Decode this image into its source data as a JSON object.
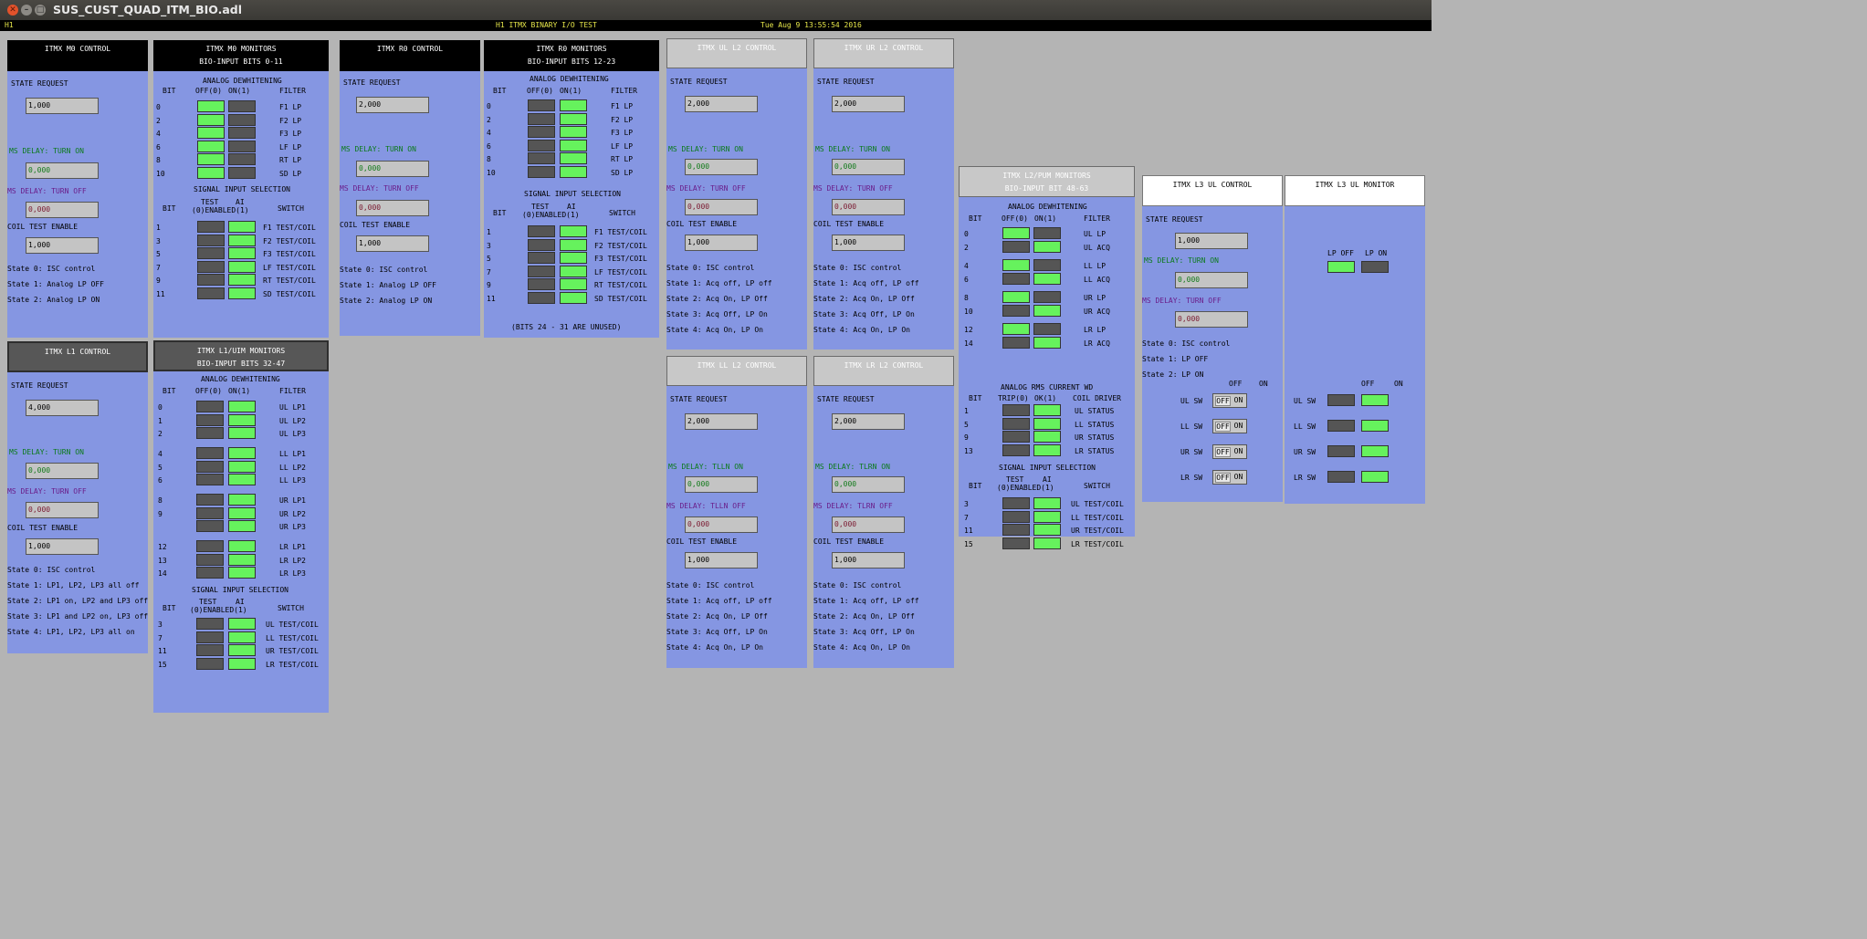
{
  "window": {
    "title": "SUS_CUST_QUAD_ITM_BIO.adl"
  },
  "status": {
    "site": "H1",
    "screen": "H1 ITMX BINARY I/O TEST",
    "datetime": "Tue Aug  9 13:55:54 2016"
  },
  "colors": {
    "panel": "#8596e2",
    "led_on": "#66f25d",
    "led_off": "#555555",
    "background": "#b4b4b4"
  },
  "m0_ctrl": {
    "title": "ITMX M0 CONTROL",
    "state_request_label": "STATE REQUEST",
    "state_request": "1,000",
    "delay_on_label": "MS DELAY: TURN ON",
    "delay_on": "0,000",
    "delay_off_label": "MS DELAY: TURN OFF",
    "delay_off": "0,000",
    "coil_label": "COIL TEST ENABLE",
    "coil": "1,000",
    "states": [
      "State 0: ISC control",
      "State 1: Analog LP OFF",
      "State 2: Analog LP ON"
    ]
  },
  "r0_ctrl": {
    "title": "ITMX R0 CONTROL",
    "state_request_label": "STATE REQUEST",
    "state_request": "2,000",
    "delay_on_label": "MS DELAY: TURN ON",
    "delay_on": "0,000",
    "delay_off_label": "MS DELAY: TURN OFF",
    "delay_off": "0,000",
    "coil_label": "COIL TEST ENABLE",
    "coil": "1,000",
    "states": [
      "State 0: ISC control",
      "State 1: Analog LP OFF",
      "State 2: Analog LP ON"
    ]
  },
  "l1_ctrl": {
    "title": "ITMX L1 CONTROL",
    "state_request_label": "STATE REQUEST",
    "state_request": "4,000",
    "delay_on_label": "MS DELAY: TURN ON",
    "delay_on": "0,000",
    "delay_off_label": "MS DELAY: TURN OFF",
    "delay_off": "0,000",
    "coil_label": "COIL TEST ENABLE",
    "coil": "1,000",
    "states": [
      "State 0: ISC control",
      "State 1: LP1, LP2, LP3 all off",
      "State 2: LP1 on, LP2 and LP3 off",
      "State 3: LP1 and LP2 on, LP3 off",
      "State 4: LP1, LP2, LP3 all on"
    ]
  },
  "ul_l2_ctrl": {
    "title": "ITMX UL L2 CONTROL",
    "state_request_label": "STATE REQUEST",
    "state_request": "2,000",
    "delay_on_label": "MS DELAY: TURN ON",
    "delay_on": "0,000",
    "delay_off_label": "MS DELAY: TURN OFF",
    "delay_off": "0,000",
    "coil_label": "COIL TEST ENABLE",
    "coil": "1,000",
    "states": [
      "State 0: ISC control",
      "State 1: Acq off, LP off",
      "State 2: Acq On, LP Off",
      "State 3: Acq Off, LP On",
      "State 4: Acq On, LP On"
    ]
  },
  "ur_l2_ctrl": {
    "title": "ITMX UR L2 CONTROL",
    "state_request_label": "STATE REQUEST",
    "state_request": "2,000",
    "delay_on_label": "MS DELAY: TURN ON",
    "delay_on": "0,000",
    "delay_off_label": "MS DELAY: TURN OFF",
    "delay_off": "0,000",
    "coil_label": "COIL TEST ENABLE",
    "coil": "1,000",
    "states": [
      "State 0: ISC control",
      "State 1: Acq off, LP off",
      "State 2: Acq On, LP Off",
      "State 3: Acq Off, LP On",
      "State 4: Acq On, LP On"
    ]
  },
  "ll_l2_ctrl": {
    "title": "ITMX LL L2 CONTROL",
    "state_request_label": "STATE REQUEST",
    "state_request": "2,000",
    "delay_on_label": "MS DELAY: TLLN ON",
    "delay_on": "0,000",
    "delay_off_label": "MS DELAY: TLLN OFF",
    "delay_off": "0,000",
    "coil_label": "COIL TEST ENABLE",
    "coil": "1,000",
    "states": [
      "State 0: ISC control",
      "State 1: Acq off, LP off",
      "State 2: Acq On, LP Off",
      "State 3: Acq Off, LP On",
      "State 4: Acq On, LP On"
    ]
  },
  "lr_l2_ctrl": {
    "title": "ITMX LR L2 CONTROL",
    "state_request_label": "STATE REQUEST",
    "state_request": "2,000",
    "delay_on_label": "MS DELAY: TLRN ON",
    "delay_on": "0,000",
    "delay_off_label": "MS DELAY: TLRN OFF",
    "delay_off": "0,000",
    "coil_label": "COIL TEST ENABLE",
    "coil": "1,000",
    "states": [
      "State 0: ISC control",
      "State 1: Acq off, LP off",
      "State 2: Acq On, LP Off",
      "State 3: Acq Off, LP On",
      "State 4: Acq On, LP On"
    ]
  },
  "l3_ctrl": {
    "title": "ITMX L3 UL CONTROL",
    "state_request_label": "STATE REQUEST",
    "state_request": "1,000",
    "delay_on_label": "MS DELAY: TURN ON",
    "delay_on": "0,000",
    "delay_off_label": "MS DELAY: TURN OFF",
    "delay_off": "0,000",
    "states": [
      "State 0: ISC control",
      "State 1: LP OFF",
      "State 2: LP ON"
    ],
    "off_label": "OFF",
    "on_label": "ON",
    "switch_labels": [
      "UL SW",
      "LL SW",
      "UR SW",
      "LR SW"
    ],
    "toggle_off": "OFF",
    "toggle_on": "ON",
    "sw_states": [
      false,
      false,
      false,
      false,
      true,
      true,
      true,
      true
    ]
  },
  "l3_mon": {
    "title": "ITMX L3 UL MONITOR",
    "lp_off_label": "LP OFF",
    "lp_on_label": "LP ON",
    "lp_states": [
      true,
      false
    ]
  },
  "m0_mon": {
    "title1": "ITMX M0 MONITORS",
    "title2": "BIO-INPUT BITS 0-11",
    "dw_title": "ANALOG DEWHITENING",
    "col_bit": "BIT",
    "col_off": "OFF(0)",
    "col_on": "ON(1)",
    "col_filter": "FILTER",
    "dw_bits": [
      "0",
      "2",
      "4",
      "6",
      "8",
      "10"
    ],
    "dw_filters": [
      "F1 LP",
      "F2 LP",
      "F3 LP",
      "LF LP",
      "RT LP",
      "SD LP"
    ],
    "dw_states": [
      true,
      false,
      true,
      false,
      true,
      false,
      true,
      false,
      true,
      false,
      true,
      false
    ],
    "sig_title": "SIGNAL INPUT SELECTION",
    "col_test": "TEST",
    "col_ai": "AI",
    "col_enabled": "(0)ENABLED(1)",
    "col_switch": "SWITCH",
    "sig_bits": [
      "1",
      "3",
      "5",
      "7",
      "9",
      "11"
    ],
    "sig_switches": [
      "F1 TEST/COIL",
      "F2 TEST/COIL",
      "F3 TEST/COIL",
      "LF TEST/COIL",
      "RT TEST/COIL",
      "SD TEST/COIL"
    ],
    "sig_states": [
      false,
      true,
      false,
      true,
      false,
      true,
      false,
      true,
      false,
      true,
      false,
      true
    ]
  },
  "r0_mon": {
    "title1": "ITMX R0 MONITORS",
    "title2": "BIO-INPUT BITS 12-23",
    "dw_title": "ANALOG DEWHITENING",
    "col_bit": "BIT",
    "col_off": "OFF(0)",
    "col_on": "ON(1)",
    "col_filter": "FILTER",
    "dw_bits": [
      "0",
      "2",
      "4",
      "6",
      "8",
      "10"
    ],
    "dw_filters": [
      "F1 LP",
      "F2 LP",
      "F3 LP",
      "LF LP",
      "RT LP",
      "SD LP"
    ],
    "dw_states": [
      false,
      true,
      false,
      true,
      false,
      true,
      false,
      true,
      false,
      true,
      false,
      true
    ],
    "sig_title": "SIGNAL INPUT SELECTION",
    "col_test": "TEST",
    "col_ai": "AI",
    "col_enabled": "(0)ENABLED(1)",
    "col_switch": "SWITCH",
    "sig_bits": [
      "1",
      "3",
      "5",
      "7",
      "9",
      "11"
    ],
    "sig_switches": [
      "F1 TEST/COIL",
      "F2 TEST/COIL",
      "F3 TEST/COIL",
      "LF TEST/COIL",
      "RT TEST/COIL",
      "SD TEST/COIL"
    ],
    "sig_states": [
      false,
      true,
      false,
      true,
      false,
      true,
      false,
      true,
      false,
      true,
      false,
      true
    ],
    "note": "(BITS 24 - 31 ARE UNUSED)"
  },
  "l1_mon": {
    "title1": "ITMX L1/UIM MONITORS",
    "title2": "BIO-INPUT BITS 32-47",
    "dw_title": "ANALOG DEWHITENING",
    "col_bit": "BIT",
    "col_off": "OFF(0)",
    "col_on": "ON(1)",
    "col_filter": "FILTER",
    "dw_bits": [
      "0",
      "1",
      "2",
      "4",
      "5",
      "6",
      "8",
      "9",
      "",
      "12",
      "13",
      "14"
    ],
    "dw_filters": [
      "UL LP1",
      "UL LP2",
      "UL LP3",
      "LL LP1",
      "LL LP2",
      "LL LP3",
      "UR LP1",
      "UR LP2",
      "UR LP3",
      "LR LP1",
      "LR LP2",
      "LR LP3"
    ],
    "dw_states": [
      false,
      true,
      false,
      true,
      false,
      true,
      false,
      true,
      false,
      true,
      false,
      true,
      false,
      true,
      false,
      true,
      false,
      true,
      false,
      true,
      false,
      true,
      false,
      true
    ],
    "sig_title": "SIGNAL INPUT SELECTION",
    "col_test": "TEST",
    "col_ai": "AI",
    "col_enabled": "(0)ENABLED(1)",
    "col_switch": "SWITCH",
    "sig_bits": [
      "3",
      "7",
      "11",
      "15"
    ],
    "sig_switches": [
      "UL TEST/COIL",
      "LL TEST/COIL",
      "UR TEST/COIL",
      "LR TEST/COIL"
    ],
    "sig_states": [
      false,
      true,
      false,
      true,
      false,
      true,
      false,
      true
    ]
  },
  "l2_mon": {
    "title1": "ITMX L2/PUM MONITORS",
    "title2": "BIO-INPUT BIT 48-63",
    "dw_title": "ANALOG DEWHITENING",
    "col_bit": "BIT",
    "col_off": "OFF(0)",
    "col_on": "ON(1)",
    "col_filter": "FILTER",
    "dw_bits": [
      "0",
      "2",
      "4",
      "6",
      "8",
      "10",
      "12",
      "14"
    ],
    "dw_filters": [
      "UL LP",
      "UL ACQ",
      "LL LP",
      "LL ACQ",
      "UR LP",
      "UR ACQ",
      "LR LP",
      "LR ACQ"
    ],
    "dw_states": [
      true,
      false,
      false,
      true,
      true,
      false,
      false,
      true,
      true,
      false,
      false,
      true,
      true,
      false,
      false,
      true
    ],
    "rms_title": "ANALOG RMS CURRENT WD",
    "col_trip": "TRIP(0)",
    "col_ok": "OK(1)",
    "col_coil": "COIL DRIVER",
    "rms_bits": [
      "1",
      "5",
      "9",
      "13"
    ],
    "rms_labels": [
      "UL STATUS",
      "LL STATUS",
      "UR STATUS",
      "LR STATUS"
    ],
    "rms_states": [
      false,
      true,
      false,
      true,
      false,
      true,
      false,
      true
    ],
    "sig_title": "SIGNAL INPUT SELECTION",
    "col_test": "TEST",
    "col_ai": "AI",
    "col_enabled": "(0)ENABLED(1)",
    "col_switch": "SWITCH",
    "sig_bits": [
      "3",
      "7",
      "11",
      "15"
    ],
    "sig_switches": [
      "UL TEST/COIL",
      "LL TEST/COIL",
      "UR TEST/COIL",
      "LR TEST/COIL"
    ],
    "sig_states": [
      false,
      true,
      false,
      true,
      false,
      true,
      false,
      true
    ]
  }
}
